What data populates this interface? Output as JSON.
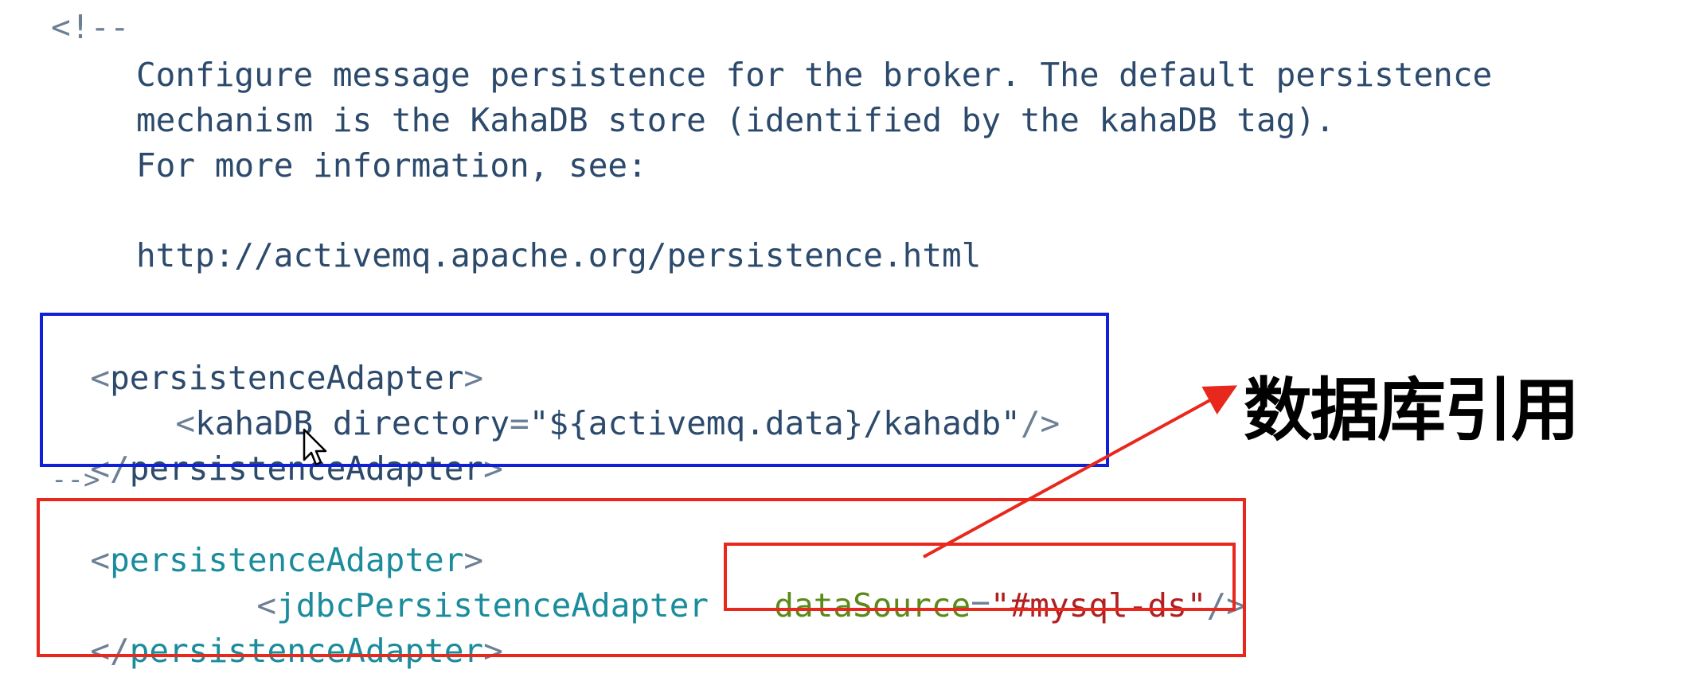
{
  "comment": {
    "open": "<!--",
    "lines": [
      "Configure message persistence for the broker. The default persistence",
      "mechanism is the KahaDB store (identified by the kahaDB tag).",
      "For more information, see:",
      "http://activemq.apache.org/persistence.html"
    ],
    "close": "-->"
  },
  "kaha_block": {
    "open_tag": "persistenceAdapter",
    "inner_tag": "kahaDB",
    "inner_attr": "directory",
    "inner_value": "\"${activemq.data}/kahadb\"",
    "close_tag": "persistenceAdapter"
  },
  "jdbc_block": {
    "open_tag": "persistenceAdapter",
    "inner_tag": "jdbcPersistenceAdapter",
    "inner_attr": "dataSource",
    "inner_value": "\"#mysql-ds\"",
    "close_tag": "persistenceAdapter"
  },
  "punct": {
    "lt": "<",
    "gt": ">",
    "lt_slash": "</",
    "self_close": "/>",
    "eq": "="
  },
  "annotation": {
    "label": "数据库引用"
  },
  "colors": {
    "blue_box": "#1020d8",
    "red_box": "#e8281c",
    "tag": "#1b8c9c",
    "attr": "#5a8a1a",
    "value": "#b02020"
  }
}
